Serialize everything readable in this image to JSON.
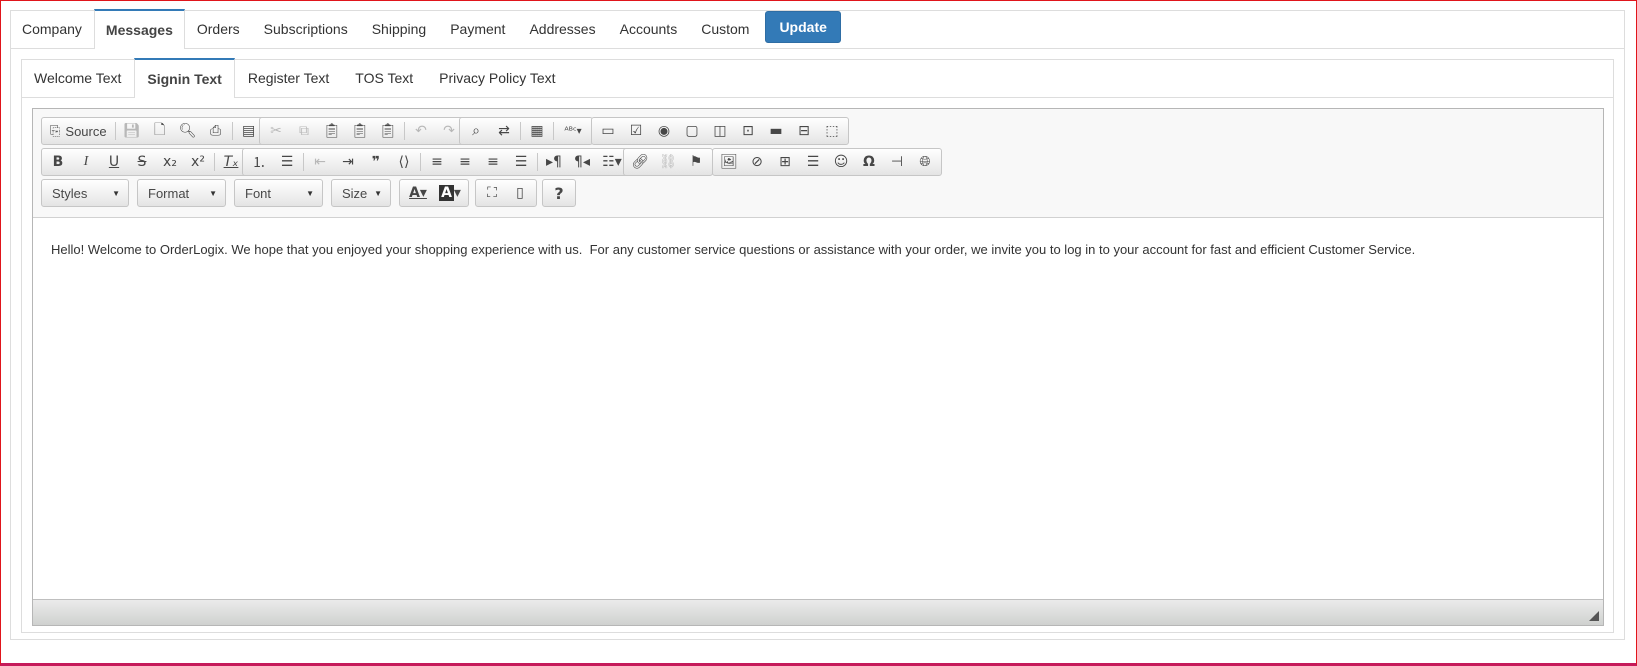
{
  "main_tabs": [
    {
      "label": "Company"
    },
    {
      "label": "Messages",
      "active": true
    },
    {
      "label": "Orders"
    },
    {
      "label": "Subscriptions"
    },
    {
      "label": "Shipping"
    },
    {
      "label": "Payment"
    },
    {
      "label": "Addresses"
    },
    {
      "label": "Accounts"
    },
    {
      "label": "Custom"
    }
  ],
  "update_button": "Update",
  "sub_tabs": [
    {
      "label": "Welcome Text"
    },
    {
      "label": "Signin Text",
      "active": true
    },
    {
      "label": "Register Text"
    },
    {
      "label": "TOS Text"
    },
    {
      "label": "Privacy Policy Text"
    }
  ],
  "editor": {
    "source_label": "Source",
    "combos": {
      "styles": "Styles",
      "format": "Format",
      "font": "Font",
      "size": "Size"
    },
    "content": "Hello! Welcome to OrderLogix. We hope that you enjoyed your shopping experience with us.  For any customer service questions or assistance with your order, we invite you to log in to your account for fast and efficient Customer Service."
  },
  "colors": {
    "accent": "#337ab7",
    "frame_border": "#e0151b"
  }
}
